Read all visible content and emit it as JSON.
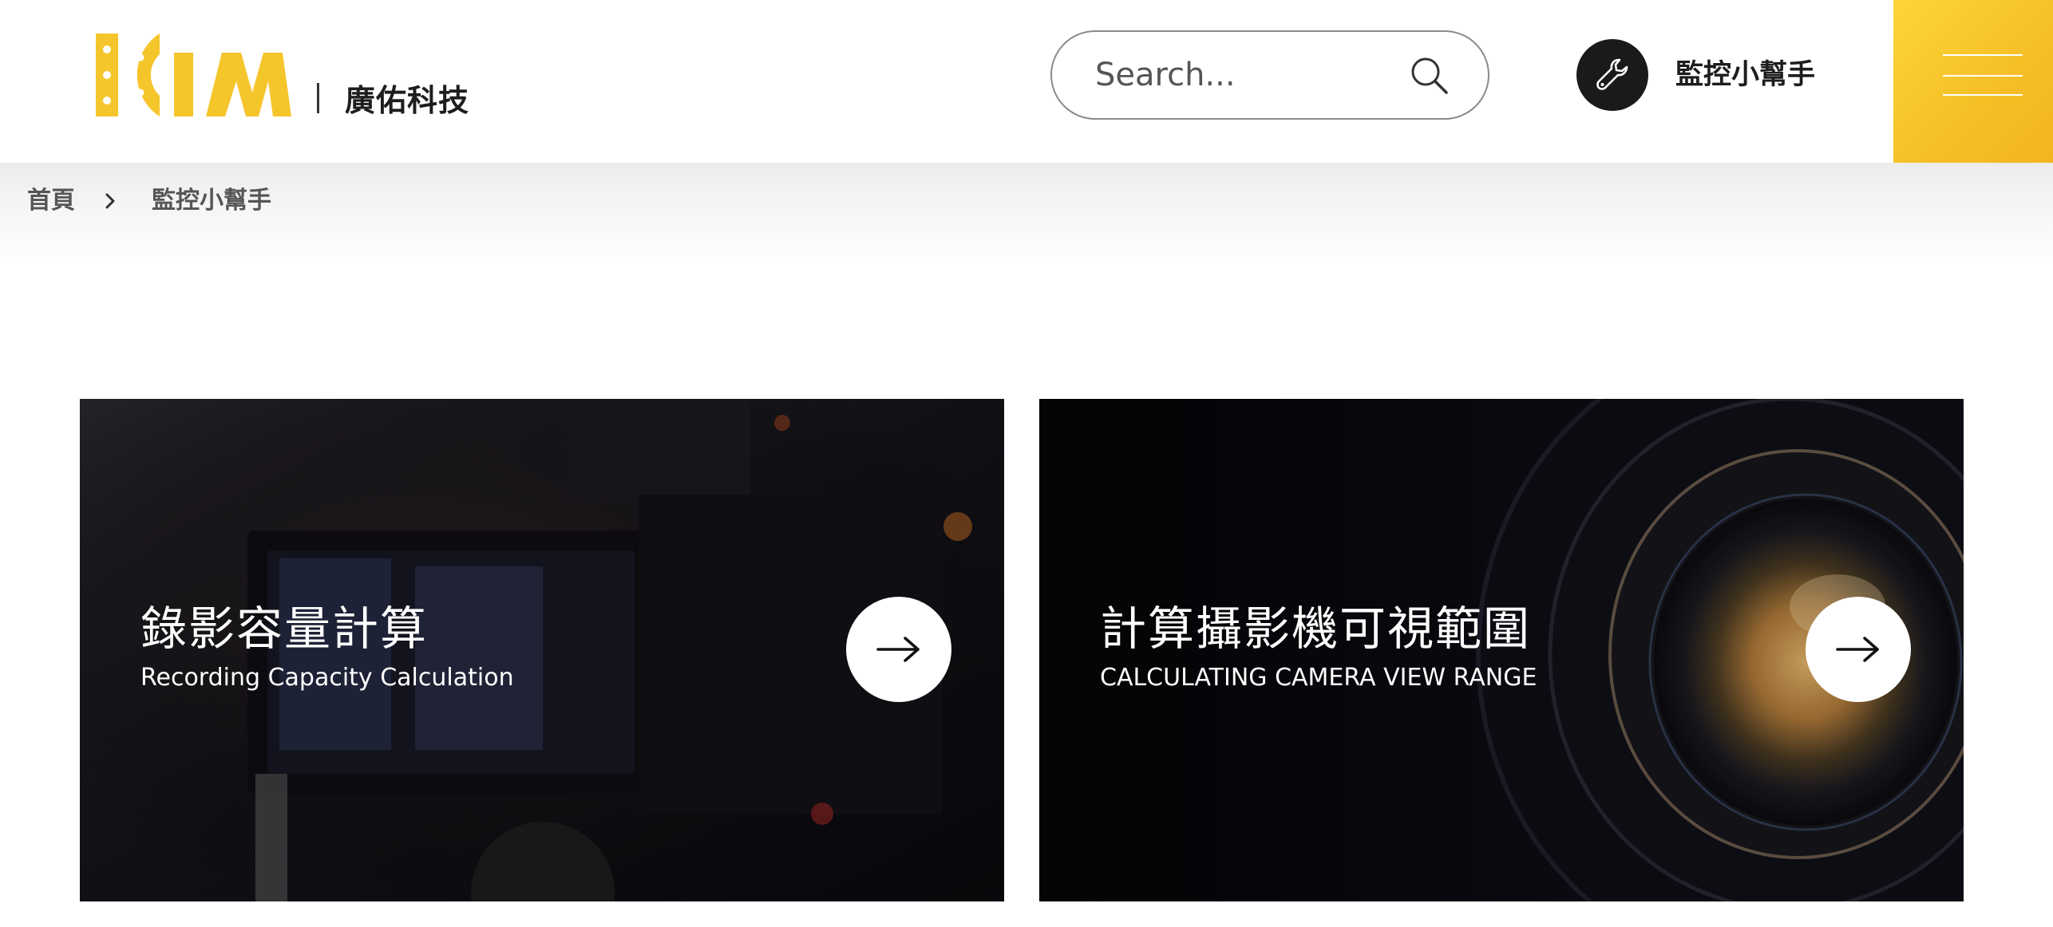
{
  "header": {
    "logo_text": "KIM",
    "company_name": "廣佑科技",
    "search": {
      "placeholder": "Search..."
    },
    "helper_link": {
      "label": "監控小幫手",
      "icon": "wrench-icon"
    },
    "menu": {
      "icon": "hamburger-menu-icon"
    }
  },
  "breadcrumb": {
    "items": [
      {
        "label": "首頁"
      },
      {
        "label": "監控小幫手"
      }
    ],
    "separator_icon": "chevron-right-icon"
  },
  "cards": [
    {
      "title": "錄影容量計算",
      "subtitle": "Recording Capacity Calculation",
      "icon": "arrow-right-icon"
    },
    {
      "title": "計算攝影機可視範圍",
      "subtitle": "CALCULATING CAMERA VIEW RANGE",
      "icon": "arrow-right-icon"
    }
  ],
  "colors": {
    "brand_yellow": "#f5c52c",
    "menu_gradient_start": "#fcd53a",
    "menu_gradient_end": "#f2b51f",
    "text_dark": "#1d1d1d",
    "card_dark": "#0c0c10"
  }
}
